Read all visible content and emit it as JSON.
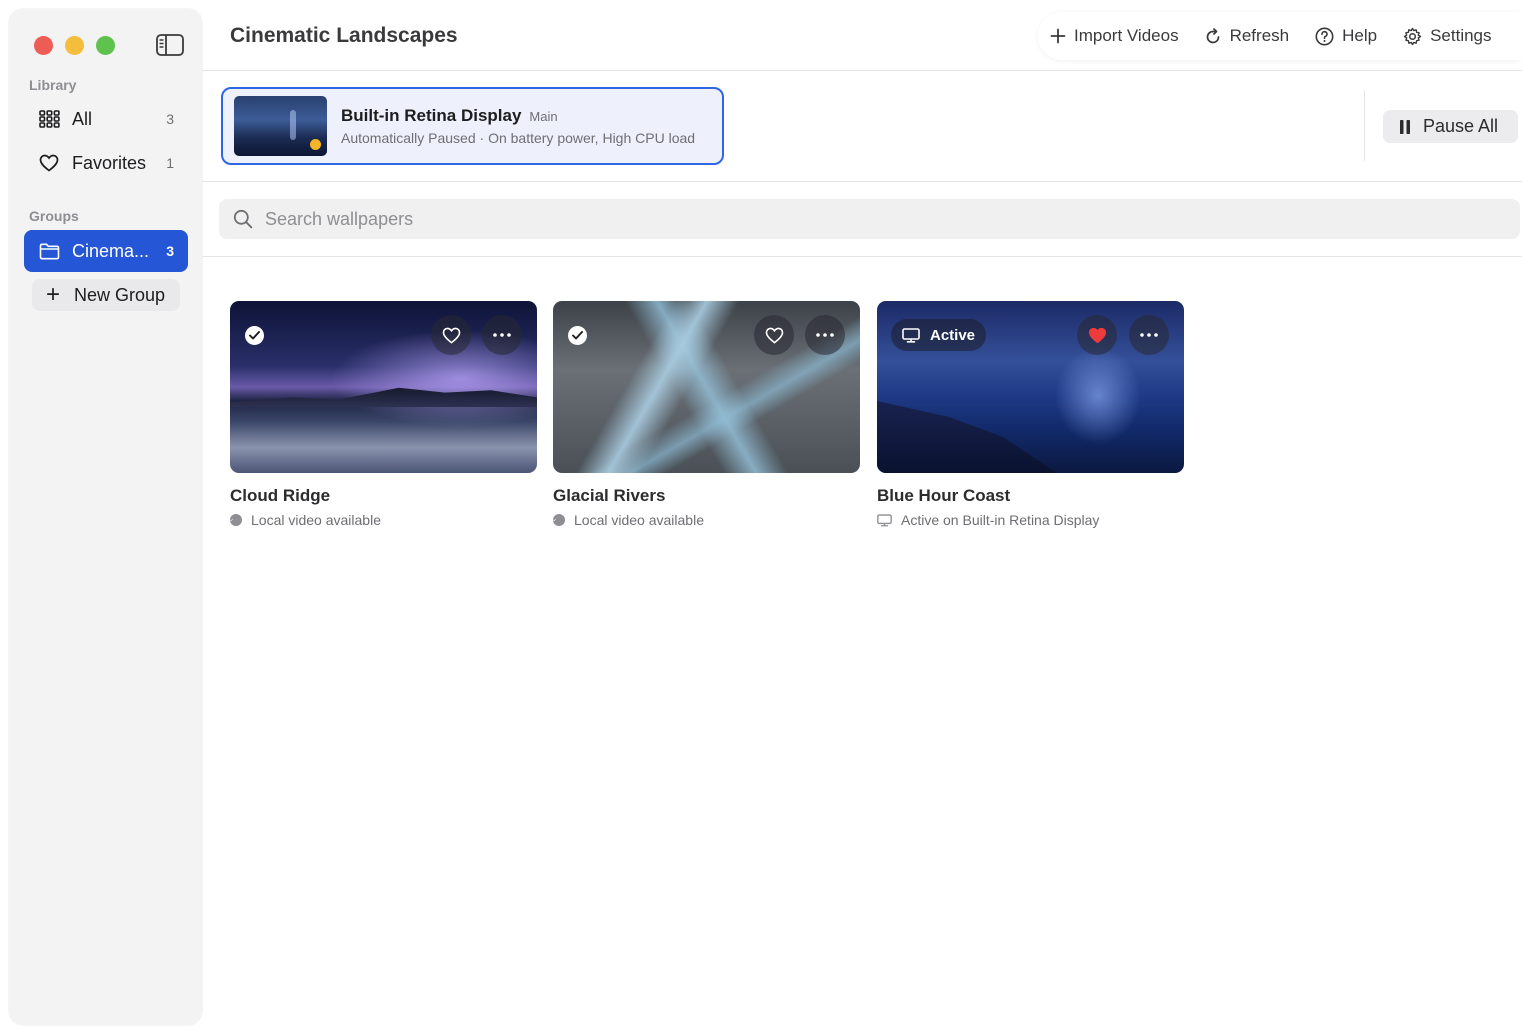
{
  "sidebar": {
    "library_label": "Library",
    "items": [
      {
        "label": "All",
        "count": "3"
      },
      {
        "label": "Favorites",
        "count": "1"
      }
    ],
    "groups_label": "Groups",
    "groups": [
      {
        "label": "Cinema...",
        "count": "3"
      }
    ],
    "new_group_label": "New Group"
  },
  "header": {
    "title": "Cinematic Landscapes",
    "toolbar": {
      "import": "Import Videos",
      "refresh": "Refresh",
      "help": "Help",
      "settings": "Settings"
    }
  },
  "display": {
    "name": "Built-in Retina Display",
    "tag": "Main",
    "status": "Automatically Paused · On battery power, High CPU load",
    "pause_all": "Pause All"
  },
  "search": {
    "placeholder": "Search wallpapers",
    "value": ""
  },
  "wallpapers": [
    {
      "title": "Cloud Ridge",
      "subtitle": "Local video available",
      "favorite": false
    },
    {
      "title": "Glacial Rivers",
      "subtitle": "Local video available",
      "favorite": false
    },
    {
      "title": "Blue Hour Coast",
      "subtitle": "Active on Built-in Retina Display",
      "favorite": true,
      "badge": "Active"
    }
  ],
  "colors": {
    "accent": "#2456d6",
    "selection_border": "#2e66e6",
    "paused_dot": "#f4b526",
    "favorite": "#ee3b3b"
  }
}
